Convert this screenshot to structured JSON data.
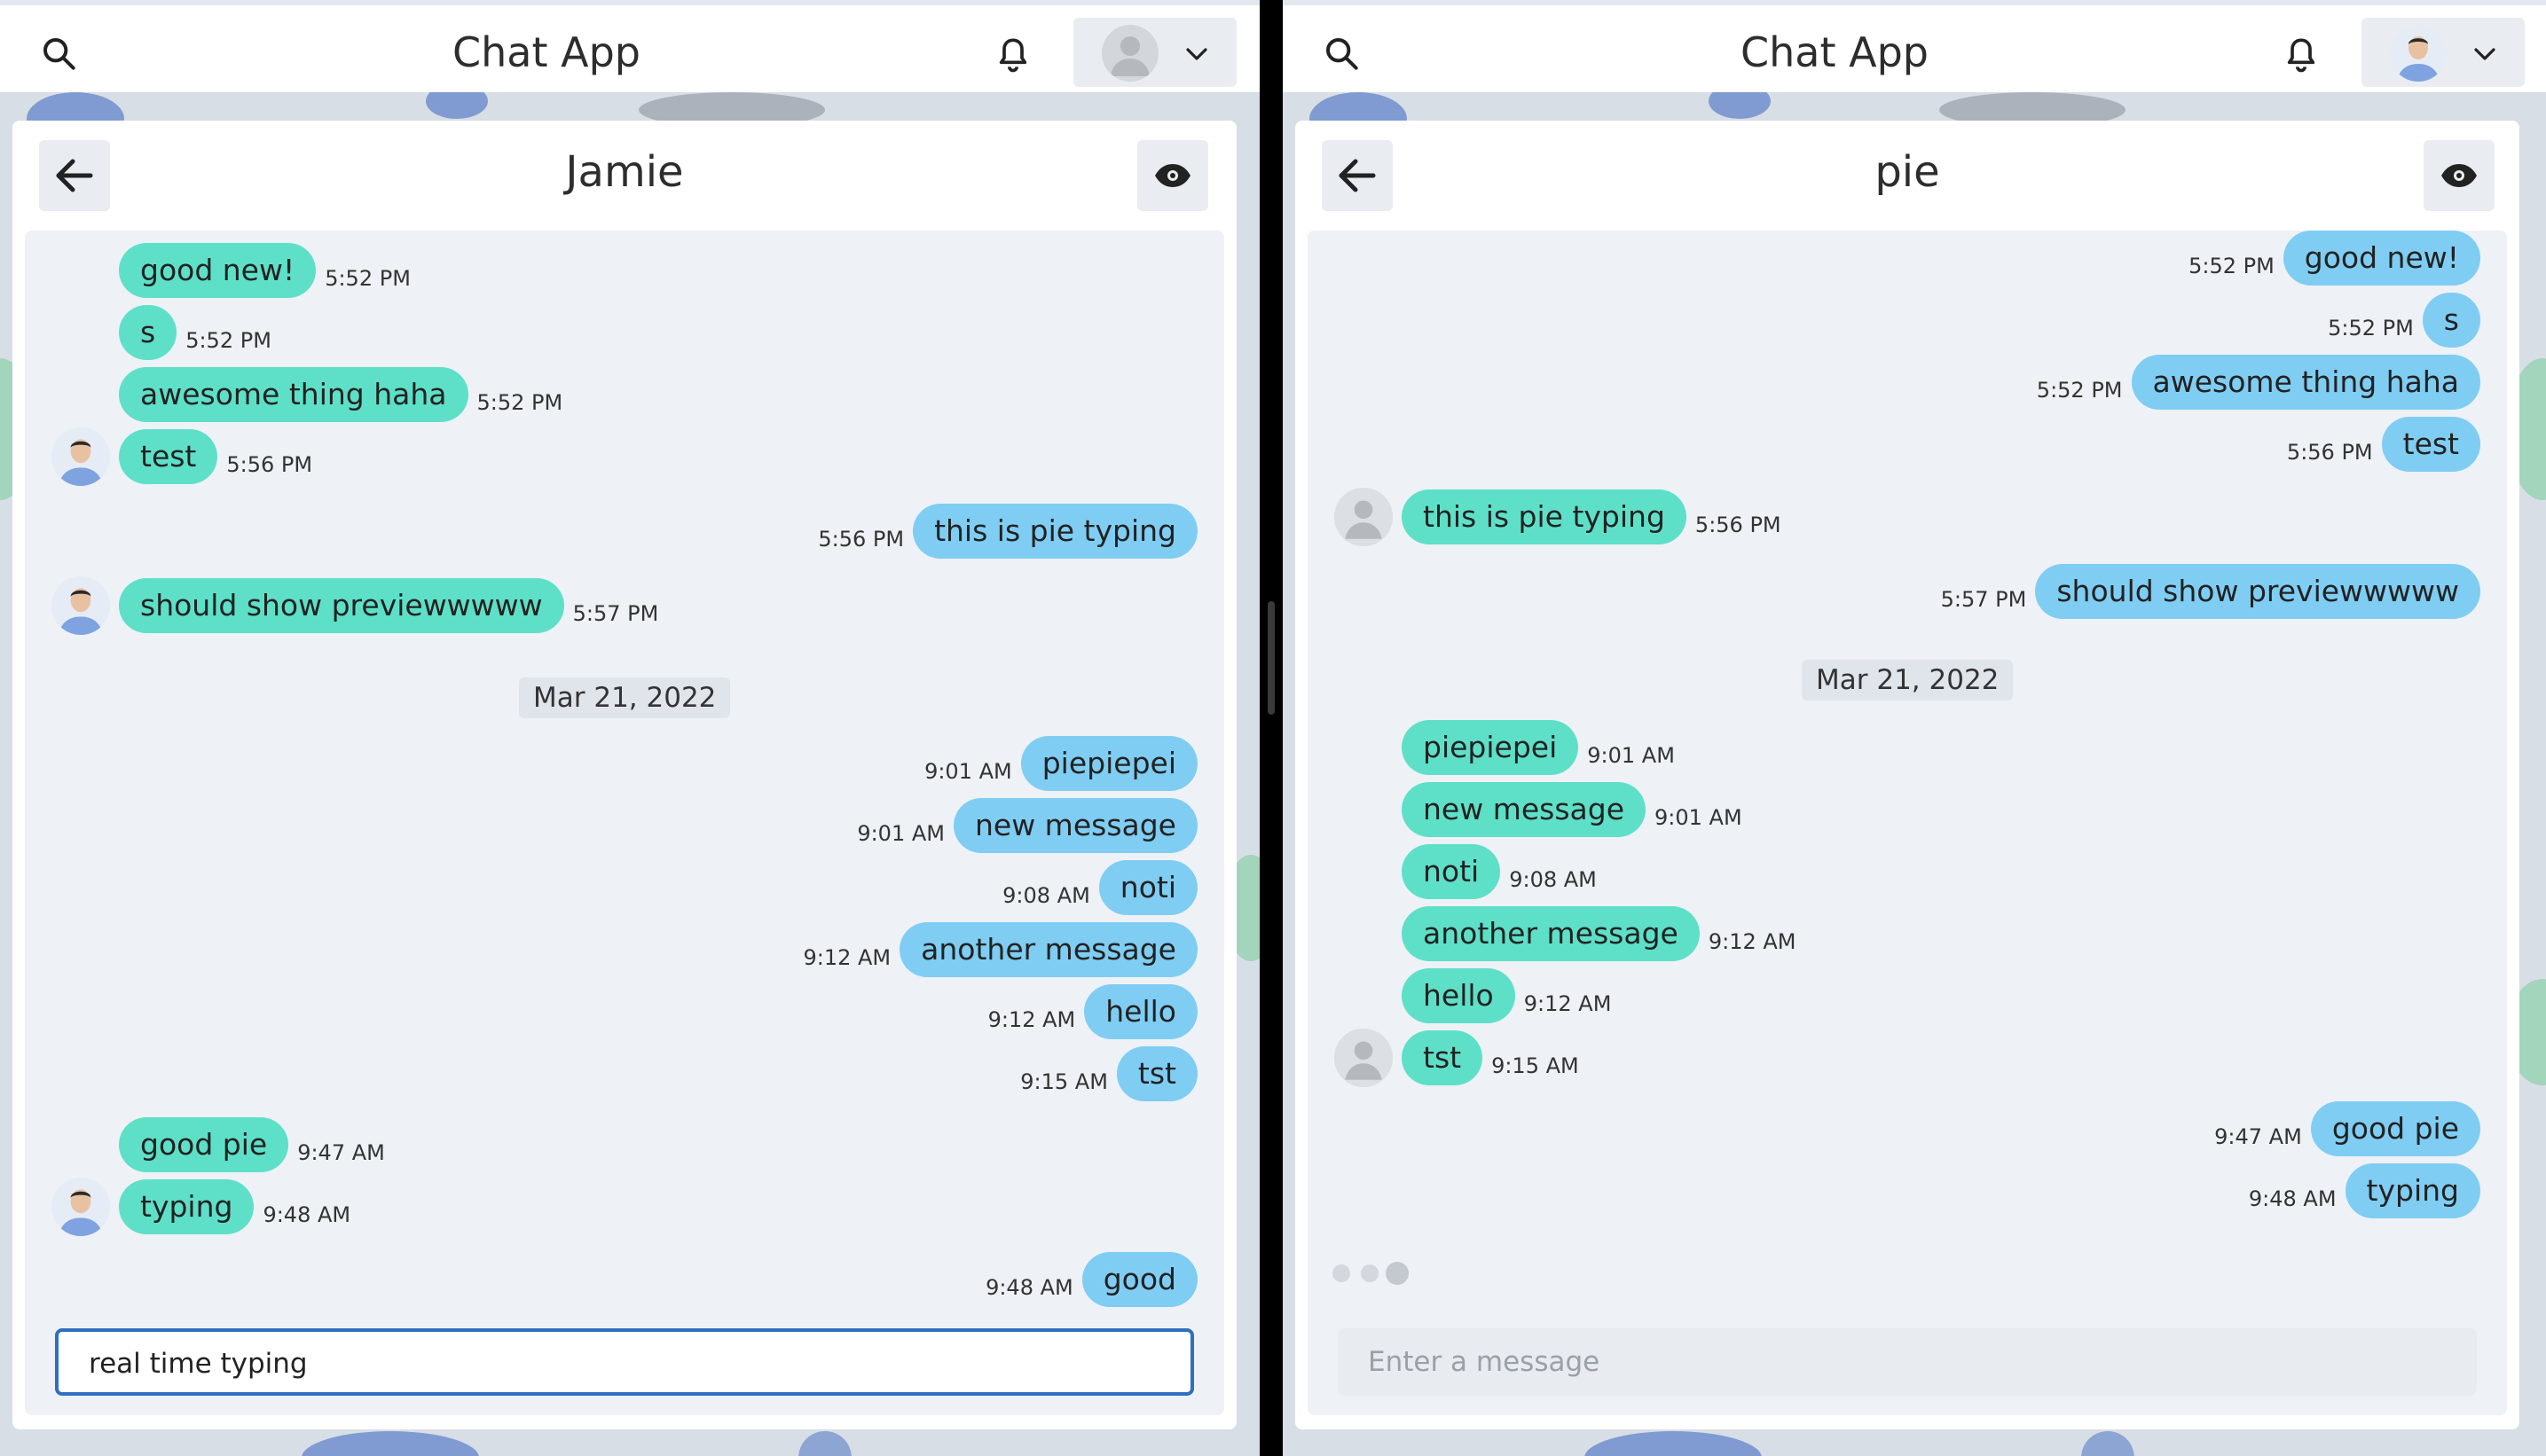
{
  "app_title": "Chat App",
  "colors": {
    "incoming": "#5ee0c8",
    "outgoing": "#7fcdf3",
    "background": "#eef1f5",
    "input_border": "#2f6fbf"
  },
  "left": {
    "contact_name": "Jamie",
    "date_chip": "Mar 21, 2022",
    "messages": [
      {
        "text": "good new!",
        "time": "5:52 PM",
        "dir": "in"
      },
      {
        "text": "s",
        "time": "5:52 PM",
        "dir": "in"
      },
      {
        "text": "awesome thing haha",
        "time": "5:52 PM",
        "dir": "in"
      },
      {
        "text": "test",
        "time": "5:56 PM",
        "dir": "in",
        "avatar": "photo"
      },
      {
        "text": "this is pie typing",
        "time": "5:56 PM",
        "dir": "out"
      },
      {
        "text": "should show previewwwww",
        "time": "5:57 PM",
        "dir": "in",
        "avatar": "photo"
      },
      {
        "text": "piepiepei",
        "time": "9:01 AM",
        "dir": "out"
      },
      {
        "text": "new message",
        "time": "9:01 AM",
        "dir": "out"
      },
      {
        "text": "noti",
        "time": "9:08 AM",
        "dir": "out"
      },
      {
        "text": "another message",
        "time": "9:12 AM",
        "dir": "out"
      },
      {
        "text": "hello",
        "time": "9:12 AM",
        "dir": "out"
      },
      {
        "text": "tst",
        "time": "9:15 AM",
        "dir": "out"
      },
      {
        "text": "good pie",
        "time": "9:47 AM",
        "dir": "in"
      },
      {
        "text": "typing",
        "time": "9:48 AM",
        "dir": "in",
        "avatar": "photo"
      },
      {
        "text": "good",
        "time": "9:48 AM",
        "dir": "out"
      }
    ],
    "input_value": "real time typing"
  },
  "right": {
    "contact_name": "pie",
    "date_chip": "Mar 21, 2022",
    "messages": [
      {
        "text": "good new!",
        "time": "5:52 PM",
        "dir": "out"
      },
      {
        "text": "s",
        "time": "5:52 PM",
        "dir": "out"
      },
      {
        "text": "awesome thing haha",
        "time": "5:52 PM",
        "dir": "out"
      },
      {
        "text": "test",
        "time": "5:56 PM",
        "dir": "out"
      },
      {
        "text": "this is pie typing",
        "time": "5:56 PM",
        "dir": "in",
        "avatar": "generic"
      },
      {
        "text": "should show previewwwww",
        "time": "5:57 PM",
        "dir": "out"
      },
      {
        "text": "piepiepei",
        "time": "9:01 AM",
        "dir": "in"
      },
      {
        "text": "new message",
        "time": "9:01 AM",
        "dir": "in"
      },
      {
        "text": "noti",
        "time": "9:08 AM",
        "dir": "in"
      },
      {
        "text": "another message",
        "time": "9:12 AM",
        "dir": "in"
      },
      {
        "text": "hello",
        "time": "9:12 AM",
        "dir": "in"
      },
      {
        "text": "tst",
        "time": "9:15 AM",
        "dir": "in",
        "avatar": "generic"
      },
      {
        "text": "good pie",
        "time": "9:47 AM",
        "dir": "out"
      },
      {
        "text": "typing",
        "time": "9:48 AM",
        "dir": "out"
      }
    ],
    "input_placeholder": "Enter a message",
    "typing_indicator": true
  },
  "icons": {
    "search": "search-icon",
    "bell": "bell-icon",
    "back": "arrow-left-icon",
    "eye": "eye-icon",
    "chevron": "chevron-down-icon"
  }
}
